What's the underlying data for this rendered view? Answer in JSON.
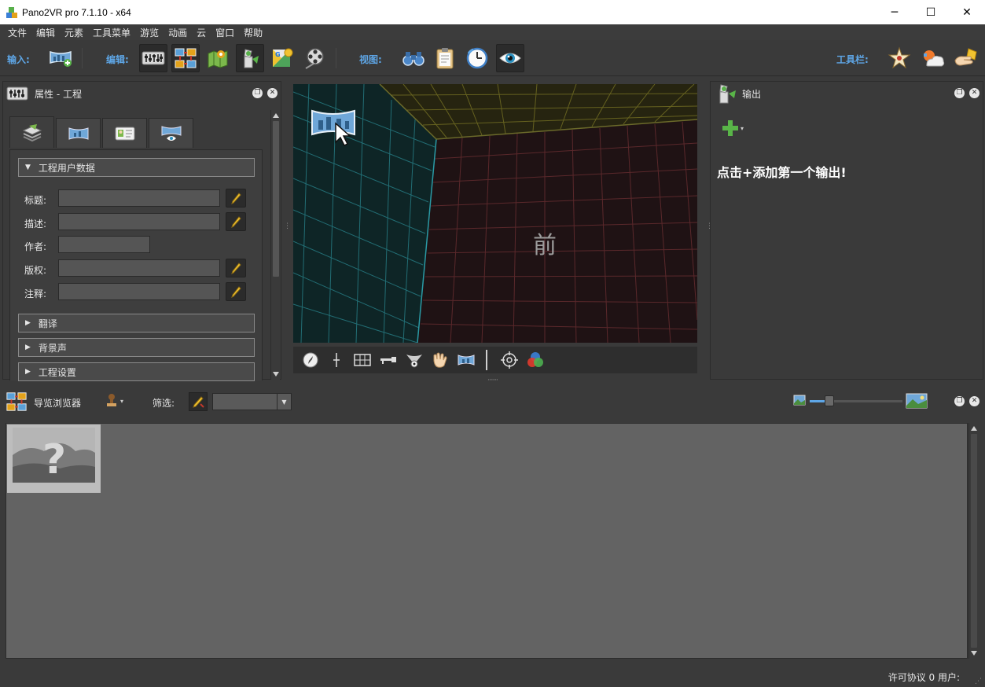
{
  "window": {
    "title": "Pano2VR pro 7.1.10 - x64",
    "minimize_glyph": "─",
    "maximize_glyph": "☐",
    "close_glyph": "✕"
  },
  "menu": [
    "文件",
    "编辑",
    "元素",
    "工具菜单",
    "游览",
    "动画",
    "云",
    "窗口",
    "帮助"
  ],
  "toolbar": {
    "input_label": "输入:",
    "edit_label": "编辑:",
    "view_label": "视图:",
    "toolbars_label": "工具栏:",
    "input_buttons": [
      "import-panorama-icon"
    ],
    "edit_buttons": [
      "properties-icon",
      "tour-browser-icon",
      "map-icon",
      "patch-icon",
      "google-street-view-icon",
      "animation-icon"
    ],
    "view_buttons": [
      "binoculars-icon",
      "clipboard-icon",
      "timer-icon",
      "eye-icon"
    ],
    "toolbar_buttons": [
      "starburst-icon",
      "weather-icon",
      "hand-icon"
    ]
  },
  "properties_panel": {
    "title": "属性 - 工程",
    "tabs": [
      "project-icon",
      "panorama-tab-icon",
      "user-data-tab-icon",
      "viewer-tab-icon"
    ],
    "section_user_data": "工程用户数据",
    "fields": [
      {
        "label": "标题:",
        "value": ""
      },
      {
        "label": "描述:",
        "value": ""
      },
      {
        "label": "作者:",
        "value": ""
      },
      {
        "label": "版权:",
        "value": ""
      },
      {
        "label": "注释:",
        "value": ""
      }
    ],
    "sections_collapsed": [
      "翻译",
      "背景声",
      "工程设置"
    ]
  },
  "viewer": {
    "face_label": "前",
    "tools": [
      "compass-icon",
      "crosshair-line-icon",
      "grid-icon",
      "key-icon",
      "cone-icon",
      "hand-icon",
      "panorama-icon",
      "target-icon",
      "color-circles-icon"
    ]
  },
  "output_panel": {
    "title": "输出",
    "message": "点击+添加第一个输出!"
  },
  "tour_browser": {
    "title": "导览浏览器",
    "filter_label": "筛选:",
    "filter_value": ""
  },
  "status": {
    "text": "许可协议 0 用户:"
  },
  "colors": {
    "accent": "#5ea6e6",
    "panel": "#3a3a3a",
    "browser_bg": "#636363"
  }
}
